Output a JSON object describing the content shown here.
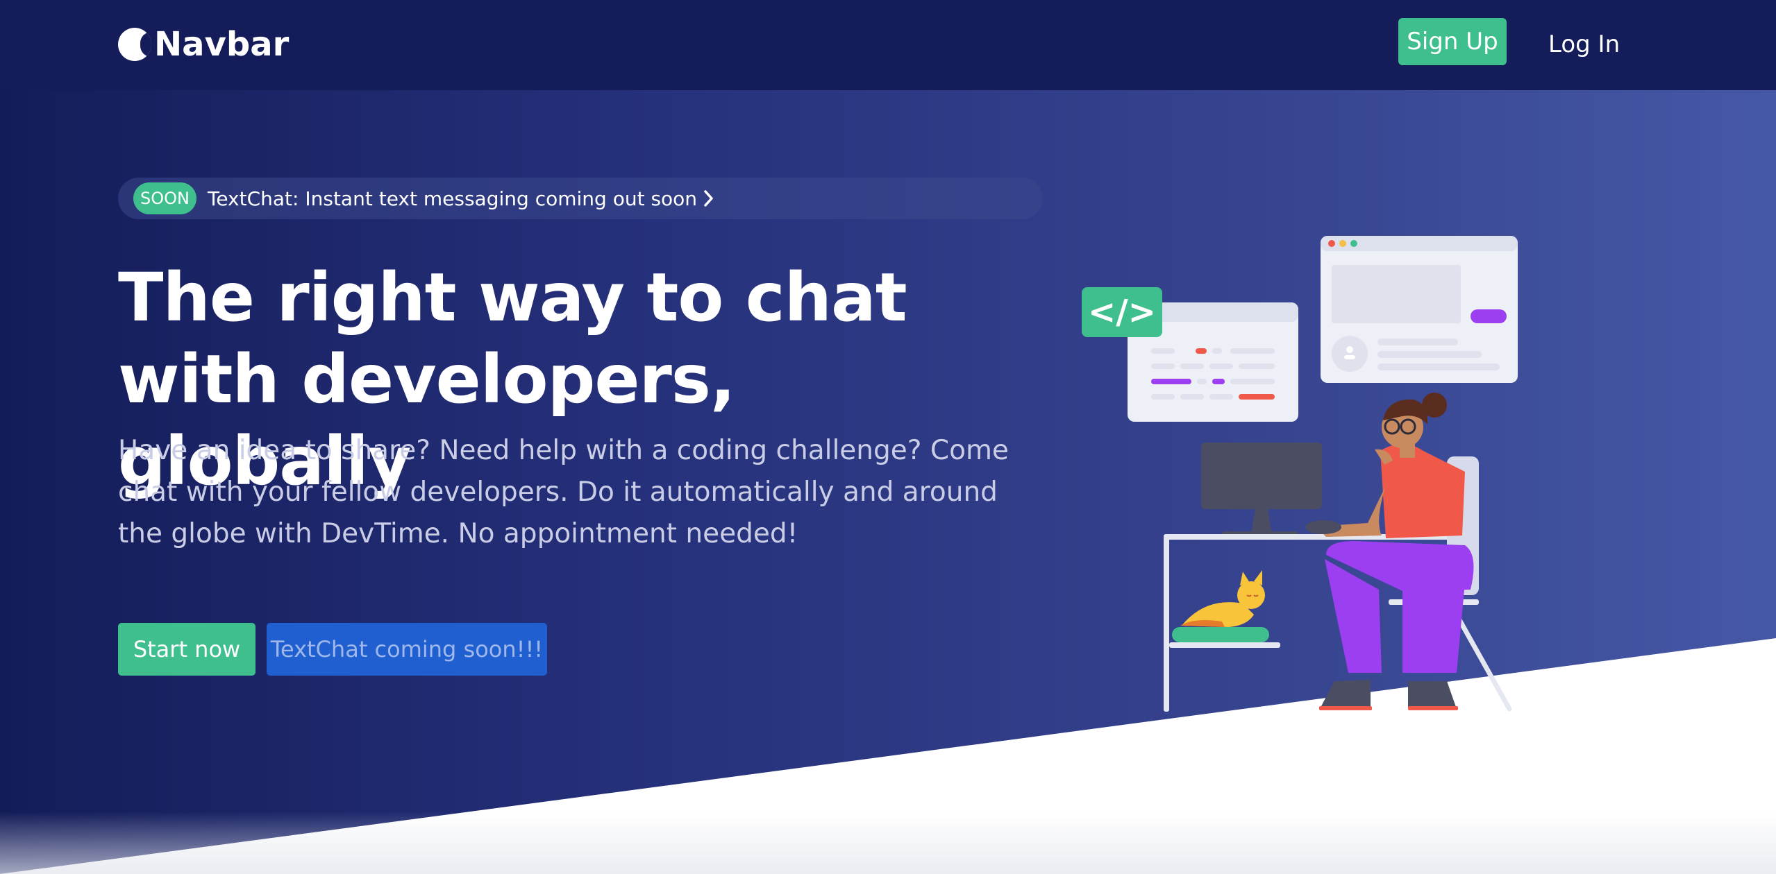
{
  "navbar": {
    "brand": "Navbar",
    "signup_label": "Sign Up",
    "login_label": "Log In"
  },
  "announcement": {
    "badge": "SOON",
    "text": "TextChat: Instant text messaging coming out soon"
  },
  "hero": {
    "headline": "The right way to chat with developers, globally",
    "subtext": "Have an idea to share? Need help with a coding challenge? Come chat with your fellow developers. Do it automatically and around the globe with DevTime. No appointment needed!",
    "primary_cta": "Start now",
    "secondary_cta": "TextChat coming soon!!!"
  },
  "illustration": {
    "code_badge": "</>",
    "description_icon": "developer-at-desk-illustration"
  },
  "colors": {
    "navbar_bg": "#141c5a",
    "accent_green": "#3ebf8d",
    "accent_blue": "#1f5fcf",
    "accent_purple": "#9b3ff0"
  }
}
